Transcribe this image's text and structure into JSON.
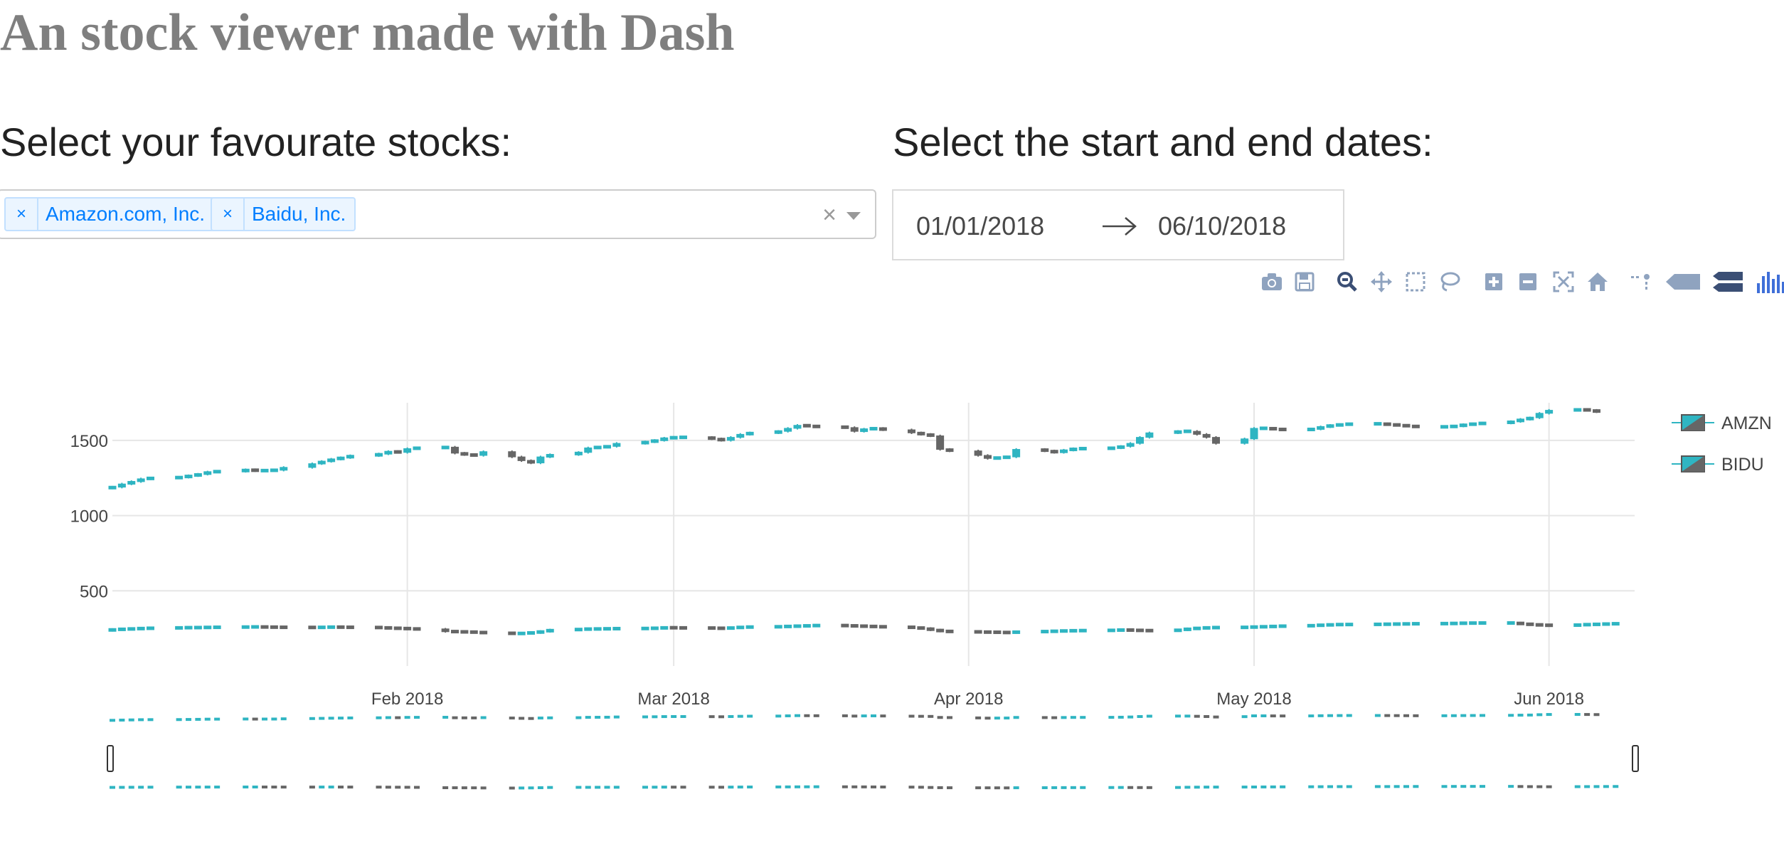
{
  "page": {
    "title": "An stock viewer made with Dash",
    "stocks_label": "Select your favourate stocks:",
    "dates_label": "Select the start and end dates:"
  },
  "stock_dropdown": {
    "selected": [
      {
        "label": "Amazon.com, Inc.",
        "value": "AMZN"
      },
      {
        "label": "Baidu, Inc.",
        "value": "BIDU"
      }
    ],
    "remove_symbol": "×",
    "clear_symbol": "×"
  },
  "date_range": {
    "start": "01/01/2018",
    "end": "06/10/2018"
  },
  "modebar": {
    "buttons": [
      "camera-icon",
      "save-icon",
      "zoom-icon",
      "pan-icon",
      "box-select-icon",
      "lasso-select-icon",
      "zoom-in-icon",
      "zoom-out-icon",
      "autoscale-icon",
      "reset-axes-icon",
      "spike-lines-icon",
      "hover-closest-icon",
      "hover-compare-icon",
      "plotly-logo-icon"
    ]
  },
  "chart_data": {
    "type": "candlestick",
    "x_ticks": [
      "Feb 2018",
      "Mar 2018",
      "Apr 2018",
      "May 2018",
      "Jun 2018"
    ],
    "y_ticks": [
      "500",
      "1000",
      "1500"
    ],
    "ylim": [
      0,
      1750
    ],
    "date_range": [
      "2018-01-01",
      "2018-06-10"
    ],
    "grid": true,
    "legend_position": "top-right",
    "rangeslider": true,
    "colors": {
      "increasing": "#2fb5c2",
      "decreasing": "#666666",
      "grid": "#e6e6e6"
    },
    "series": [
      {
        "name": "AMZN",
        "close": [
          1189,
          1210,
          1226,
          1244,
          1250,
          1255,
          1265,
          1275,
          1290,
          1294,
          1305,
          1298,
          1300,
          1302,
          1320,
          1345,
          1360,
          1375,
          1385,
          1398,
          1410,
          1426,
          1420,
          1445,
          1450,
          1455,
          1415,
          1405,
          1400,
          1425,
          1390,
          1365,
          1350,
          1390,
          1405,
          1420,
          1450,
          1455,
          1460,
          1480,
          1490,
          1500,
          1515,
          1520,
          1520,
          1510,
          1500,
          1520,
          1540,
          1550,
          1560,
          1580,
          1600,
          1595,
          1590,
          1585,
          1560,
          1575,
          1580,
          1570,
          1550,
          1540,
          1530,
          1440,
          1430,
          1400,
          1380,
          1385,
          1390,
          1440,
          1430,
          1420,
          1435,
          1445,
          1445,
          1450,
          1460,
          1480,
          1520,
          1550,
          1560,
          1560,
          1540,
          1520,
          1480,
          1510,
          1580,
          1580,
          1575,
          1570,
          1575,
          1590,
          1600,
          1605,
          1610,
          1610,
          1605,
          1600,
          1595,
          1590,
          1590,
          1595,
          1605,
          1610,
          1615,
          1625,
          1640,
          1650,
          1680,
          1700,
          1705,
          1700,
          1690
        ]
      },
      {
        "name": "BIDU",
        "close": [
          243,
          245,
          248,
          250,
          252,
          255,
          255,
          256,
          257,
          258,
          260,
          260,
          259,
          258,
          257,
          256,
          258,
          259,
          258,
          257,
          255,
          252,
          250,
          248,
          245,
          230,
          228,
          226,
          225,
          220,
          215,
          218,
          222,
          230,
          240,
          245,
          246,
          247,
          248,
          249,
          250,
          252,
          255,
          254,
          253,
          252,
          250,
          255,
          258,
          260,
          262,
          264,
          266,
          268,
          270,
          268,
          266,
          264,
          262,
          260,
          255,
          250,
          240,
          232,
          228,
          226,
          225,
          224,
          222,
          228,
          230,
          232,
          234,
          235,
          236,
          238,
          240,
          238,
          236,
          235,
          240,
          248,
          252,
          255,
          256,
          258,
          260,
          262,
          264,
          266,
          270,
          272,
          275,
          276,
          276,
          278,
          278,
          280,
          280,
          282,
          282,
          284,
          285,
          286,
          286,
          286,
          280,
          275,
          272,
          270,
          274,
          276,
          278,
          280,
          282
        ]
      }
    ]
  }
}
